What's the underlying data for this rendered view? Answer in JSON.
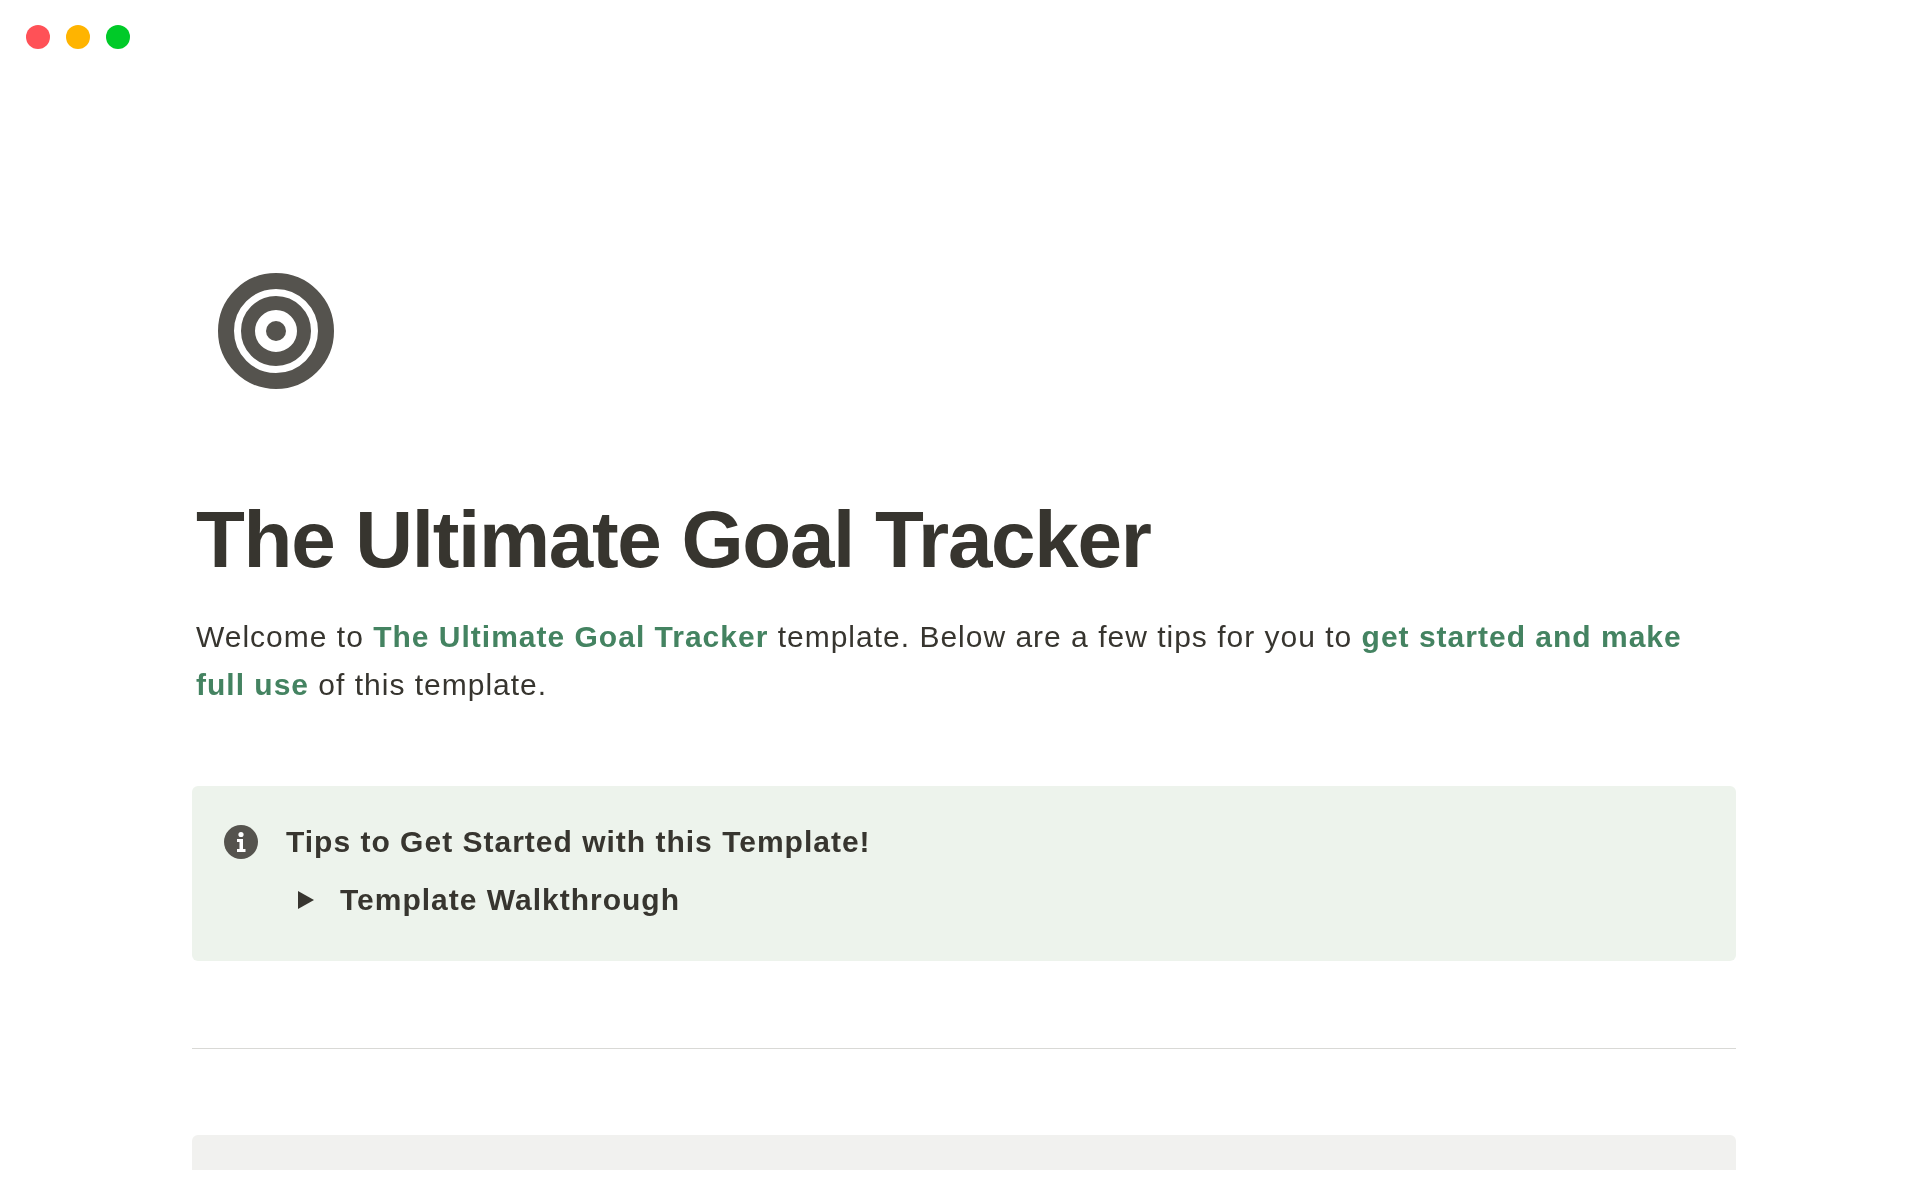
{
  "window": {
    "controls": [
      {
        "color": "#ff5157"
      },
      {
        "color": "#ffb400"
      },
      {
        "color": "#00ca28"
      }
    ]
  },
  "page": {
    "title": "The Ultimate Goal Tracker",
    "intro": [
      {
        "kind": "plain",
        "text": "Welcome to "
      },
      {
        "kind": "highlight",
        "text": "The Ultimate Goal Tracker"
      },
      {
        "kind": "plain",
        "text": " template. Below are a few tips for you to "
      },
      {
        "kind": "highlight",
        "text": "get started and make full use"
      },
      {
        "kind": "plain",
        "text": " of this template."
      }
    ],
    "callout": {
      "title": "Tips to Get Started with this Template!",
      "toggles": [
        {
          "label": "Template Walkthrough",
          "expanded": false
        }
      ]
    }
  }
}
